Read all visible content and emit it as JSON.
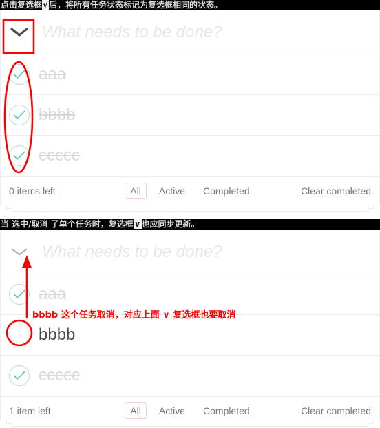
{
  "annotations": {
    "banner_top": {
      "before": "点击复选框",
      "highlight": "√",
      "after": "后，将所有任务状态标记为复选框相同的状态。"
    },
    "banner_mid": {
      "before": "当 选中/取消 了单个任务时，复选框",
      "highlight": "∨",
      "after": "也应同步更新。"
    },
    "red_note": "bbbb 这个任务取消，对应上面 ∨ 复选框也要取消",
    "accent_color": "#ff0000",
    "shapes": [
      {
        "name": "toggle-all-highlight-rect",
        "type": "rect"
      },
      {
        "name": "checkbox-column-highlight-ellipse",
        "type": "ellipse"
      },
      {
        "name": "pointer-arrow-to-toggle-all",
        "type": "arrow"
      },
      {
        "name": "bbbb-checkbox-highlight-circle",
        "type": "circle"
      }
    ]
  },
  "theme": {
    "check_color": "#5dc2af",
    "chevron_color": "#4d4d4d",
    "filter_selected_border": "#f4cfd3",
    "completed_text": "#d9d9d9",
    "text": "#4d4d4d"
  },
  "panels": [
    {
      "id": "panel-1",
      "toggle_all_icon": "chevron-down-icon",
      "new_todo": {
        "value": "",
        "placeholder": "What needs to be done?"
      },
      "todos": [
        {
          "label": "aaa",
          "completed": true
        },
        {
          "label": "bbbb",
          "completed": true
        },
        {
          "label": "ccccc",
          "completed": true
        }
      ],
      "footer": {
        "count": "0 items left",
        "filters": [
          {
            "label": "All",
            "selected": true
          },
          {
            "label": "Active",
            "selected": false
          },
          {
            "label": "Completed",
            "selected": false
          }
        ],
        "clear": "Clear completed"
      }
    },
    {
      "id": "panel-2",
      "toggle_all_icon": "chevron-down-icon",
      "new_todo": {
        "value": "",
        "placeholder": "What needs to be done?"
      },
      "todos": [
        {
          "label": "aaa",
          "completed": true
        },
        {
          "label": "bbbb",
          "completed": false
        },
        {
          "label": "ccccc",
          "completed": true
        }
      ],
      "footer": {
        "count": "1 item left",
        "filters": [
          {
            "label": "All",
            "selected": true
          },
          {
            "label": "Active",
            "selected": false
          },
          {
            "label": "Completed",
            "selected": false
          }
        ],
        "clear": "Clear completed"
      }
    }
  ]
}
